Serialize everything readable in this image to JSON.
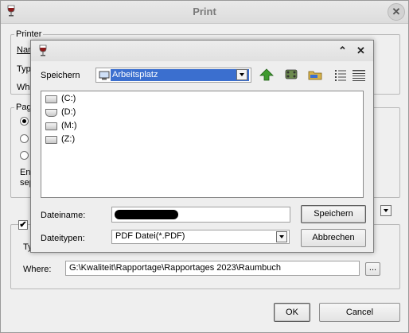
{
  "print_window": {
    "title": "Print",
    "printer_group": {
      "legend": "Printer",
      "rows": [
        "Nam",
        "Typ",
        "Whe"
      ]
    },
    "page_group": {
      "legend": "Pag",
      "note_line1": "Ent",
      "note_line2": "sep"
    },
    "lower_group": {
      "type_label": "Ty",
      "where_label": "Where:",
      "where_value": "G:\\Kwaliteit\\Rapportage\\Rapportages 2023\\Raumbuch",
      "browse_label": "..."
    },
    "ok_label": "OK",
    "cancel_label": "Cancel"
  },
  "save_dialog": {
    "save_in_label": "Speichern",
    "location_value": "Arbeitsplatz",
    "drives": [
      "(C:)",
      "(D:)",
      "(M:)",
      "(Z:)"
    ],
    "filename_label": "Dateiname:",
    "filetype_label": "Dateitypen:",
    "filetype_value": "PDF Datei(*.PDF)",
    "save_button": "Speichern",
    "cancel_button": "Abbrechen",
    "titlebar_up_symbol": "⌃",
    "titlebar_close_symbol": "✕"
  },
  "colors": {
    "wine_icon": "#8b1a1a",
    "location_highlight": "#3b6fcf",
    "up_arrow": "#3e9a2e",
    "folder": "#d9b44a"
  },
  "icons": [
    "wine-glass-icon",
    "up-one-level-icon",
    "desktop-icon",
    "new-folder-icon",
    "list-view-icon",
    "details-view-icon",
    "drive-icon",
    "monitor-icon"
  ]
}
